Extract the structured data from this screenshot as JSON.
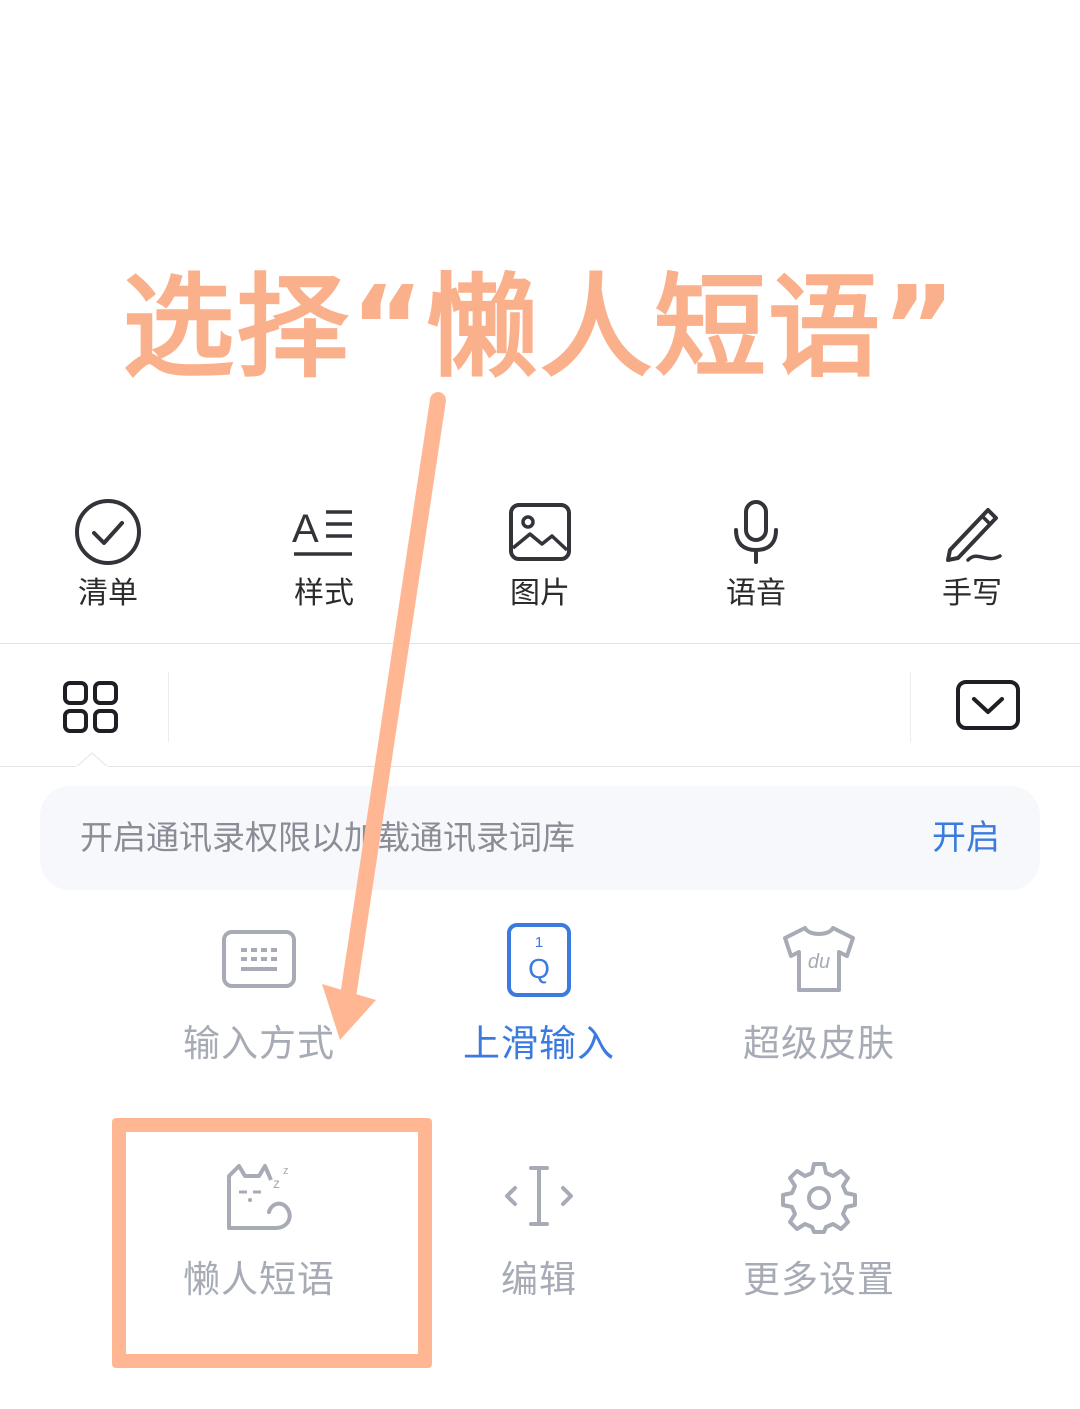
{
  "annotation": {
    "title": "选择“懒人短语”"
  },
  "toolbar": {
    "items": [
      {
        "label": "清单",
        "icon": "checklist-icon"
      },
      {
        "label": "样式",
        "icon": "text-style-icon"
      },
      {
        "label": "图片",
        "icon": "image-icon"
      },
      {
        "label": "语音",
        "icon": "microphone-icon"
      },
      {
        "label": "手写",
        "icon": "pen-icon"
      }
    ]
  },
  "keyboard_bar": {
    "left_icon": "grid-menu-icon",
    "right_icon": "collapse-keyboard-icon"
  },
  "notice": {
    "text": "开启通讯录权限以加载通讯录词库",
    "action": "开启"
  },
  "grid": {
    "items": [
      {
        "label": "输入方式",
        "icon": "keyboard-icon"
      },
      {
        "label": "上滑输入",
        "icon": "swipe-input-icon",
        "active": true
      },
      {
        "label": "超级皮肤",
        "icon": "skin-shirt-icon"
      },
      {
        "label": "懒人短语",
        "icon": "sleepy-cat-icon"
      },
      {
        "label": "编辑",
        "icon": "text-cursor-icon"
      },
      {
        "label": "更多设置",
        "icon": "gear-icon"
      }
    ]
  },
  "colors": {
    "accent_blue": "#3b7be0",
    "annotation_orange": "#fbb08c",
    "muted_gray": "#a7abb5"
  }
}
